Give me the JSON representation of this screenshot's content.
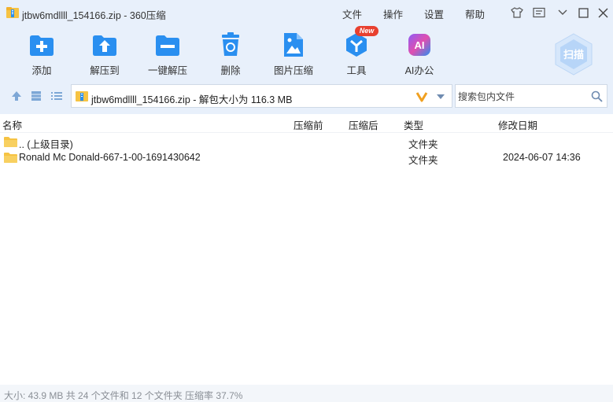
{
  "window": {
    "title": "jtbw6mdllll_154166.zip - 360压缩",
    "menu": [
      "文件",
      "操作",
      "设置",
      "帮助"
    ]
  },
  "toolbar": {
    "items": [
      {
        "label": "添加",
        "icon": "add-icon"
      },
      {
        "label": "解压到",
        "icon": "extract-to-icon"
      },
      {
        "label": "一键解压",
        "icon": "one-click-extract-icon"
      },
      {
        "label": "删除",
        "icon": "delete-icon"
      },
      {
        "label": "图片压缩",
        "icon": "image-compress-icon"
      },
      {
        "label": "工具",
        "icon": "tools-icon"
      },
      {
        "label": "AI办公",
        "icon": "ai-office-icon"
      }
    ],
    "new_badge": "New",
    "scan_label": "扫描"
  },
  "address": {
    "path": "jtbw6mdllll_154166.zip - 解包大小为 116.3 MB"
  },
  "search": {
    "placeholder": "搜索包内文件"
  },
  "columns": {
    "name": "名称",
    "compressed": "压缩前",
    "after": "压缩后",
    "type": "类型",
    "modified": "修改日期"
  },
  "rows": [
    {
      "name": ".. (上级目录)",
      "type": "文件夹",
      "modified": ""
    },
    {
      "name": "Ronald Mc Donald-667-1-00-1691430642",
      "type": "文件夹",
      "modified": "2024-06-07 14:36"
    }
  ],
  "status": {
    "text": "大小: 43.9 MB 共 24 个文件和 12 个文件夹 压缩率 37.7%"
  },
  "colors": {
    "accent": "#2a8ff0",
    "background": "#e8f0fb",
    "folder": "#f6c343"
  }
}
